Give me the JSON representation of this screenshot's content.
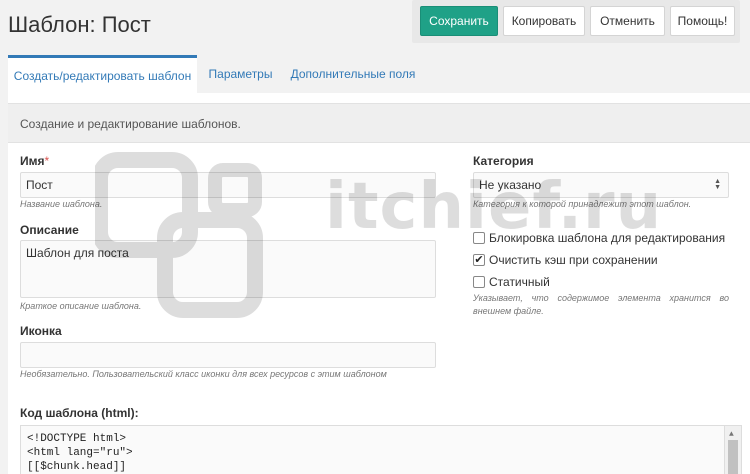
{
  "header": {
    "title": "Шаблон: Пост"
  },
  "toolbar": {
    "save": "Сохранить",
    "copy": "Копировать",
    "cancel": "Отменить",
    "help": "Помощь!"
  },
  "tabs": [
    {
      "label": "Создать/редактировать шаблон",
      "active": true
    },
    {
      "label": "Параметры",
      "active": false
    },
    {
      "label": "Дополнительные поля",
      "active": false
    }
  ],
  "panel": {
    "description": "Создание и редактирование шаблонов."
  },
  "form": {
    "name": {
      "label": "Имя",
      "required_mark": "*",
      "value": "Пост",
      "hint": "Название шаблона."
    },
    "description": {
      "label": "Описание",
      "value": "Шаблон для поста",
      "hint": "Краткое описание шаблона."
    },
    "icon": {
      "label": "Иконка",
      "value": "",
      "hint": "Необязательно. Пользовательский класс иконки для всех ресурсов с этим шаблоном"
    },
    "category": {
      "label": "Категория",
      "value": "Не указано",
      "hint": "Категория к которой принадлежит этот шаблон."
    },
    "checkboxes": [
      {
        "label": "Блокировка шаблона для редактирования",
        "checked": false
      },
      {
        "label": "Очистить кэш при сохранении",
        "checked": true
      },
      {
        "label": "Статичный",
        "checked": false
      }
    ],
    "static_hint": "Указывает, что содержимое элемента хранится во внешнем файле.",
    "code": {
      "label": "Код шаблона (html):",
      "lines": [
        "<!DOCTYPE html>",
        "<html lang=\"ru\">",
        "[[$chunk.head]]"
      ]
    }
  },
  "watermark": {
    "text": "itchief.ru"
  },
  "colors": {
    "primary": "#1fa187",
    "link": "#337ab7",
    "background": "#f2f2f2"
  }
}
